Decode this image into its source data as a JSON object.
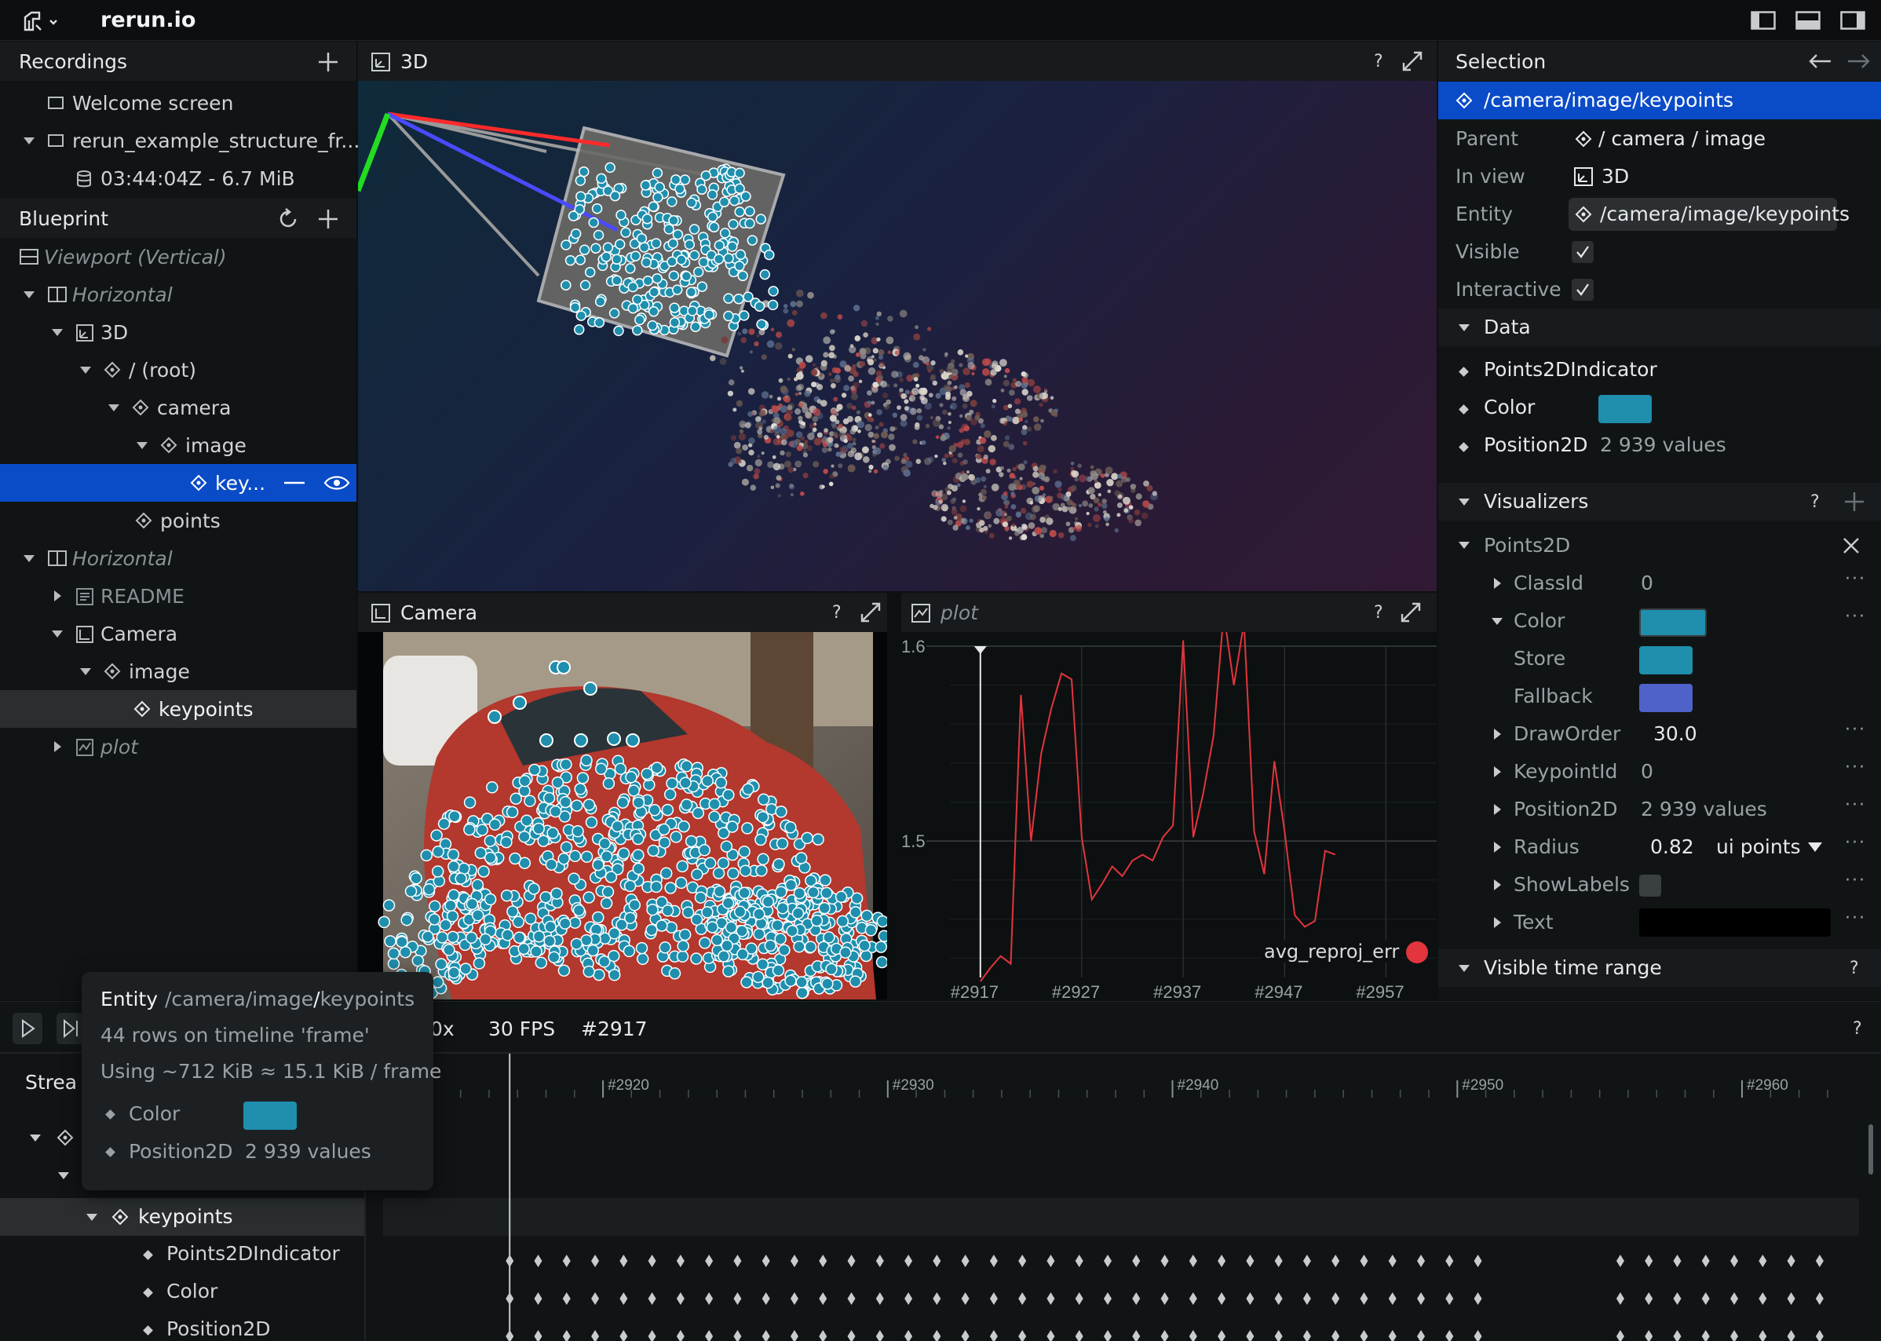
{
  "app": {
    "title": "rerun.io"
  },
  "recordings": {
    "title": "Recordings",
    "welcome": "Welcome screen",
    "recording_name": "rerun_example_structure_fr...",
    "recording_meta": "03:44:04Z - 6.7 MiB"
  },
  "blueprint": {
    "title": "Blueprint",
    "viewport": "Viewport (Vertical)",
    "horizontal_1": "Horizontal",
    "view_3d": "3D",
    "root": "/ (root)",
    "camera": "camera",
    "image": "image",
    "keypoints_short": "key...",
    "points": "points",
    "horizontal_2": "Horizontal",
    "readme": "README",
    "camera_view": "Camera",
    "cam_image": "image",
    "cam_keypoints": "keypoints",
    "plot": "plot"
  },
  "view3d": {
    "title": "3D",
    "help": "?"
  },
  "camera_view": {
    "title": "Camera",
    "help": "?"
  },
  "plot_view": {
    "title": "plot",
    "help": "?",
    "legend": "avg_reproj_err"
  },
  "chart_data": {
    "type": "line",
    "x": [
      2917,
      2918,
      2919,
      2920,
      2921,
      2922,
      2923,
      2924,
      2925,
      2926,
      2927,
      2928,
      2929,
      2930,
      2931,
      2932,
      2933,
      2934,
      2935,
      2936,
      2937,
      2938,
      2939,
      2940,
      2941,
      2942,
      2943,
      2944,
      2945,
      2946,
      2947,
      2948,
      2949,
      2950,
      2951,
      2952,
      2953,
      2954,
      2955,
      2956,
      2957,
      2958,
      2959,
      2960,
      2961,
      2962
    ],
    "y": [
      1.428,
      1.435,
      1.441,
      1.437,
      1.575,
      1.5,
      1.545,
      1.568,
      1.586,
      1.583,
      1.502,
      1.47,
      1.478,
      1.487,
      1.482,
      1.49,
      1.493,
      1.49,
      1.502,
      1.508,
      1.603,
      1.502,
      1.525,
      1.554,
      1.617,
      1.58,
      1.612,
      1.505,
      1.483,
      1.541,
      1.505,
      1.462,
      1.456,
      1.459,
      1.495,
      1.493
    ],
    "xticks": [
      "#2917",
      "#2927",
      "#2937",
      "#2947",
      "#2957"
    ],
    "yticks": [
      "1.6",
      "1.5"
    ],
    "xlim": [
      2914,
      2962
    ],
    "ylim": [
      1.43,
      1.6
    ],
    "series": [
      {
        "name": "avg_reproj_err",
        "color": "#e2353d"
      }
    ],
    "legend": "bottom-right"
  },
  "selection": {
    "title": "Selection",
    "path": "/camera/image/keypoints",
    "parent_label": "Parent",
    "parent_value": "/ camera / image",
    "in_view_label": "In view",
    "in_view_value": "3D",
    "entity_label": "Entity",
    "entity_value": "/camera/image/keypoints",
    "visible_label": "Visible",
    "interactive_label": "Interactive",
    "data_title": "Data",
    "data_items": [
      "Points2DIndicator",
      "Color",
      "Position2D"
    ],
    "position_value": "2 939 values",
    "color_hex": "#1f8fad",
    "visualizers_title": "Visualizers",
    "points2d": "Points2D",
    "classid_label": "ClassId",
    "classid_value": "0",
    "color_label": "Color",
    "store_label": "Store",
    "fallback_label": "Fallback",
    "fallback_hex": "#4f62c9",
    "draworder_label": "DrawOrder",
    "draworder_value": "30.0",
    "keypointid_label": "KeypointId",
    "keypointid_value": "0",
    "position2d_label": "Position2D",
    "position2d_value": "2 939 values",
    "radius_label": "Radius",
    "radius_value": "0.82",
    "radius_unit": "ui points",
    "showlabels_label": "ShowLabels",
    "text_label": "Text",
    "visible_time_range": "Visible time range",
    "help": "?"
  },
  "timeline": {
    "speed": "0x",
    "fps": "30 FPS",
    "frame": "#2917",
    "help": "?",
    "streams_label": "Strea",
    "ticks": [
      "#2920",
      "#2930",
      "#2940",
      "#2950",
      "#2960"
    ],
    "keypoints": "keypoints",
    "components": [
      "Points2DIndicator",
      "Color",
      "Position2D"
    ]
  },
  "tooltip": {
    "entity_label": "Entity",
    "entity_path_1": "/camera/",
    "entity_path_2": "image",
    "entity_path_3": "/",
    "entity_path_4": "keypoints",
    "rows": "44 rows on timeline 'frame'",
    "usage": "Using ~712 KiB ≈ 15.1 KiB / frame",
    "color_label": "Color",
    "position_label": "Position2D",
    "position_value": "2 939 values"
  }
}
